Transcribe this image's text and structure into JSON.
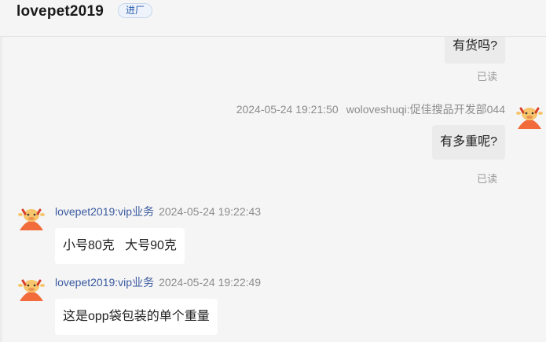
{
  "header": {
    "title": "lovepet2019",
    "badge": "进厂"
  },
  "messages": {
    "m1": {
      "text": "有货吗?",
      "status": "已读"
    },
    "m2": {
      "time": "2024-05-24 19:21:50",
      "sender": "woloveshuqi:促佳搜品开发部044",
      "text": "有多重呢?",
      "status": "已读"
    },
    "m3": {
      "sender": "lovepet2019:vip业务",
      "time": "2024-05-24 19:22:43",
      "text": "小号80克   大号90克"
    },
    "m4": {
      "sender": "lovepet2019:vip业务",
      "time": "2024-05-24 19:22:49",
      "text": "这是opp袋包装的单个重量"
    }
  },
  "colors": {
    "accent": "#3a5aa0",
    "avatar_orange": "#f26b3a",
    "avatar_yellow": "#f7c56b"
  }
}
